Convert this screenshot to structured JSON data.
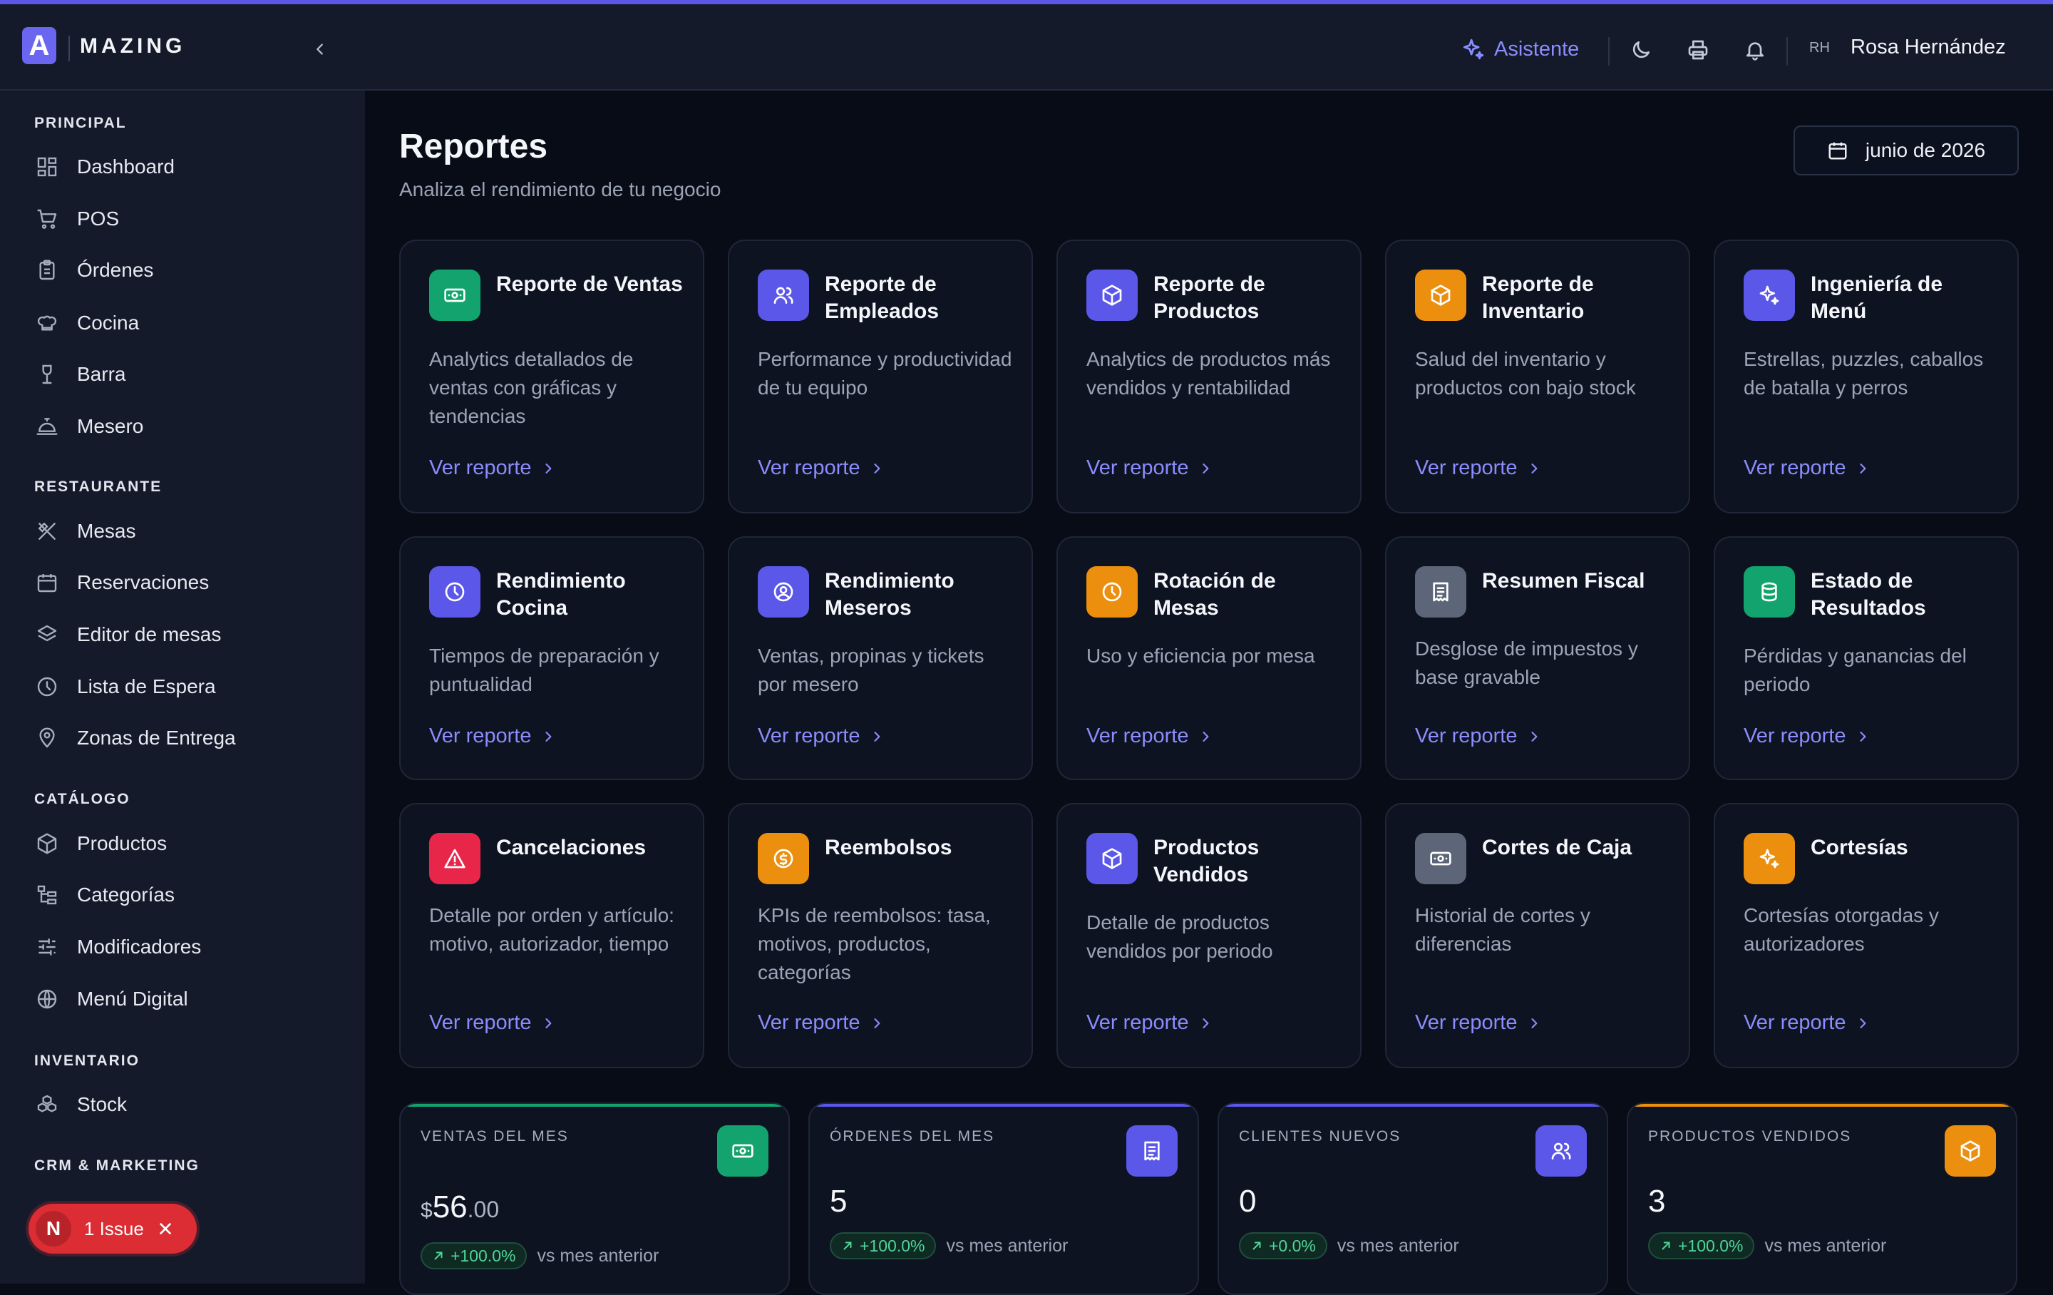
{
  "app": {
    "logo_letter": "A",
    "brand": "MAZING"
  },
  "header": {
    "assistant_label": "Asistente",
    "user_initials": "RH",
    "user_name": "Rosa Hernández"
  },
  "sidebar": {
    "sections": [
      {
        "title": "PRINCIPAL",
        "items": [
          "Dashboard",
          "POS",
          "Órdenes",
          "Cocina",
          "Barra",
          "Mesero"
        ]
      },
      {
        "title": "RESTAURANTE",
        "items": [
          "Mesas",
          "Reservaciones",
          "Editor de mesas",
          "Lista de Espera",
          "Zonas de Entrega"
        ]
      },
      {
        "title": "CATÁLOGO",
        "items": [
          "Productos",
          "Categorías",
          "Modificadores",
          "Menú Digital"
        ]
      },
      {
        "title": "INVENTARIO",
        "items": [
          "Stock"
        ]
      },
      {
        "title": "CRM & MARKETING",
        "items": []
      }
    ]
  },
  "issue": {
    "initial": "N",
    "label": "1 Issue"
  },
  "page": {
    "title": "Reportes",
    "subtitle": "Analiza el rendimiento de tu negocio",
    "date": "junio de 2026"
  },
  "link_label": "Ver reporte",
  "reports": [
    {
      "title": "Reporte de Ventas",
      "desc": "Analytics detallados de ventas con gráficas y tendencias",
      "color": "#12a36e",
      "icon": "banknote-icon"
    },
    {
      "title": "Reporte de Empleados",
      "desc": "Performance y productividad de tu equipo",
      "color": "#5b57e8",
      "icon": "users-icon"
    },
    {
      "title": "Reporte de Productos",
      "desc": "Analytics de productos más vendidos y rentabilidad",
      "color": "#5b57e8",
      "icon": "box-icon"
    },
    {
      "title": "Reporte de Inventario",
      "desc": "Salud del inventario y productos con bajo stock",
      "color": "#ec8f0e",
      "icon": "box-icon"
    },
    {
      "title": "Ingeniería de Menú",
      "desc": "Estrellas, puzzles, caballos de batalla y perros",
      "color": "#5b57e8",
      "icon": "sparkles-icon"
    },
    {
      "title": "Rendimiento Cocina",
      "desc": "Tiempos de preparación y puntualidad",
      "color": "#5b57e8",
      "icon": "clock-icon"
    },
    {
      "title": "Rendimiento Meseros",
      "desc": "Ventas, propinas y tickets por mesero",
      "color": "#5b57e8",
      "icon": "user-circle-icon"
    },
    {
      "title": "Rotación de Mesas",
      "desc": "Uso y eficiencia por mesa",
      "color": "#ec8f0e",
      "icon": "clock-icon"
    },
    {
      "title": "Resumen Fiscal",
      "desc": "Desglose de impuestos y base gravable",
      "color": "#5d6678",
      "icon": "receipt-icon"
    },
    {
      "title": "Estado de Resultados",
      "desc": "Pérdidas y ganancias del periodo",
      "color": "#12a36e",
      "icon": "coins-icon"
    },
    {
      "title": "Cancelaciones",
      "desc": "Detalle por orden y artículo: motivo, autorizador, tiempo",
      "color": "#e8264a",
      "icon": "alert-icon"
    },
    {
      "title": "Reembolsos",
      "desc": "KPIs de reembolsos: tasa, motivos, productos, categorías",
      "color": "#ec8f0e",
      "icon": "refund-icon"
    },
    {
      "title": "Productos Vendidos",
      "desc": "Detalle de productos vendidos por periodo",
      "color": "#5b57e8",
      "icon": "box-icon"
    },
    {
      "title": "Cortes de Caja",
      "desc": "Historial de cortes y diferencias",
      "color": "#5d6678",
      "icon": "banknote-icon"
    },
    {
      "title": "Cortesías",
      "desc": "Cortesías otorgadas y autorizadores",
      "color": "#ec8f0e",
      "icon": "sparkles-icon"
    }
  ],
  "stats": [
    {
      "label": "VENTAS DEL MES",
      "currency": "$",
      "value": "56",
      "decimals": ".00",
      "change": "+100.0%",
      "vs": "vs mes anterior",
      "color": "#12a36e",
      "icon": "banknote-icon"
    },
    {
      "label": "ÓRDENES DEL MES",
      "value": "5",
      "change": "+100.0%",
      "vs": "vs mes anterior",
      "color": "#5b57e8",
      "icon": "receipt-icon"
    },
    {
      "label": "CLIENTES NUEVOS",
      "value": "0",
      "change": "+0.0%",
      "vs": "vs mes anterior",
      "color": "#5b57e8",
      "icon": "users-icon"
    },
    {
      "label": "PRODUCTOS VENDIDOS",
      "value": "3",
      "change": "+100.0%",
      "vs": "vs mes anterior",
      "color": "#ec8f0e",
      "icon": "box-icon"
    }
  ]
}
